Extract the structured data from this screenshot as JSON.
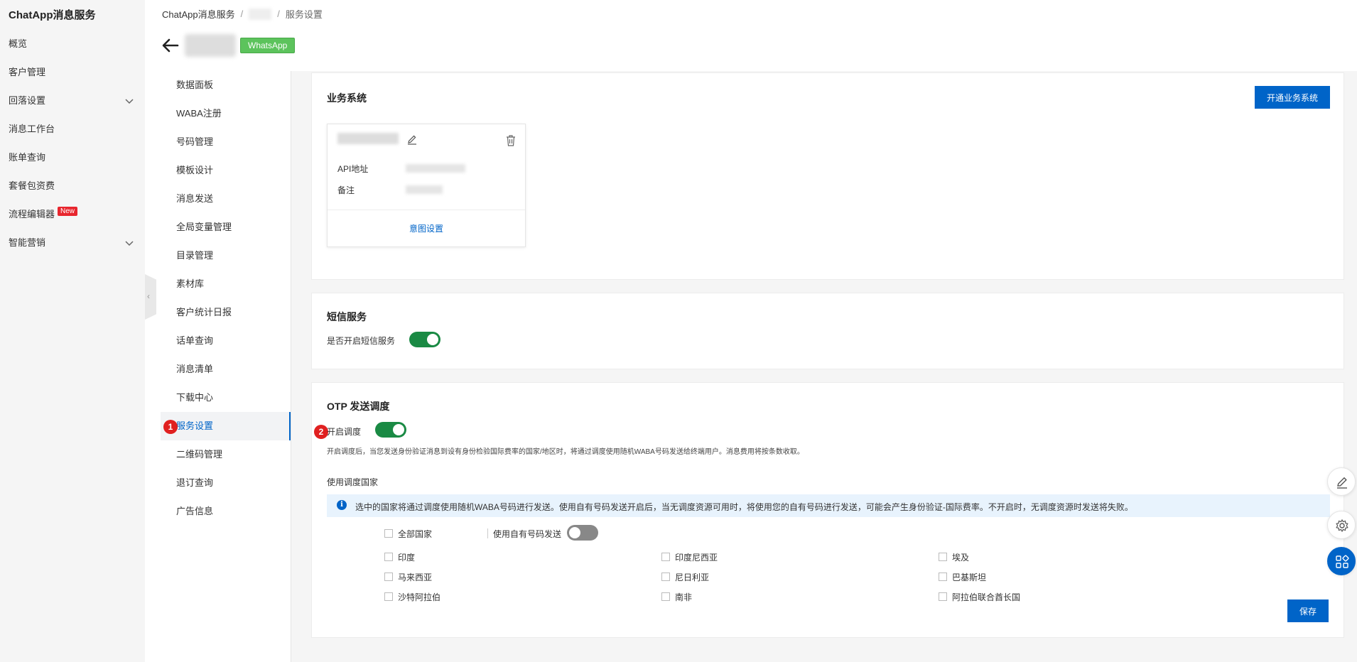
{
  "app": {
    "title": "ChatApp消息服务"
  },
  "sidebar": {
    "items": [
      {
        "label": "概览"
      },
      {
        "label": "客户管理"
      },
      {
        "label": "回落设置"
      },
      {
        "label": "消息工作台"
      },
      {
        "label": "账单查询"
      },
      {
        "label": "套餐包资费"
      },
      {
        "label": "流程编辑器",
        "badge": "New"
      },
      {
        "label": "智能营销"
      }
    ]
  },
  "breadcrumb": {
    "root": "ChatApp消息服务",
    "sep": "/",
    "current": "服务设置"
  },
  "header": {
    "channel_tag": "WhatsApp"
  },
  "subnav": {
    "items": [
      {
        "label": "数据面板"
      },
      {
        "label": "WABA注册"
      },
      {
        "label": "号码管理"
      },
      {
        "label": "模板设计"
      },
      {
        "label": "消息发送"
      },
      {
        "label": "全局变量管理"
      },
      {
        "label": "目录管理"
      },
      {
        "label": "素材库"
      },
      {
        "label": "客户统计日报"
      },
      {
        "label": "话单查询"
      },
      {
        "label": "消息清单"
      },
      {
        "label": "下载中心"
      },
      {
        "label": "服务设置"
      },
      {
        "label": "二维码管理"
      },
      {
        "label": "退订查询"
      },
      {
        "label": "广告信息"
      }
    ],
    "active_index": 12
  },
  "steps": {
    "one": "1",
    "two": "2"
  },
  "business": {
    "title": "业务系统",
    "open_button": "开通业务系统",
    "card": {
      "api_label": "API地址",
      "note_label": "备注",
      "intent_link": "意图设置"
    }
  },
  "sms": {
    "title": "短信服务",
    "toggle_label": "是否开启短信服务",
    "enabled": true
  },
  "otp": {
    "title": "OTP 发送调度",
    "toggle_label": "开启调度",
    "enabled": true,
    "description": "开启调度后，当您发送身份验证消息到设有身份检验国际费率的国家/地区时，将通过调度使用随机WABA号码发送给终端用户。消息费用将按条数收取。",
    "countries_title": "使用调度国家",
    "info": "选中的国家将通过调度使用随机WABA号码进行发送。使用自有号码发送开启后，当无调度资源可用时，将使用您的自有号码进行发送，可能会产生身份验证-国际费率。不开启时，无调度资源时发送将失败。",
    "all_countries": "全部国家",
    "own_number_label": "使用自有号码发送",
    "own_number_enabled": false,
    "countries": [
      "印度",
      "印度尼西亚",
      "埃及",
      "马来西亚",
      "尼日利亚",
      "巴基斯坦",
      "沙特阿拉伯",
      "南非",
      "阿拉伯联合酋长国"
    ],
    "save_button": "保存"
  }
}
